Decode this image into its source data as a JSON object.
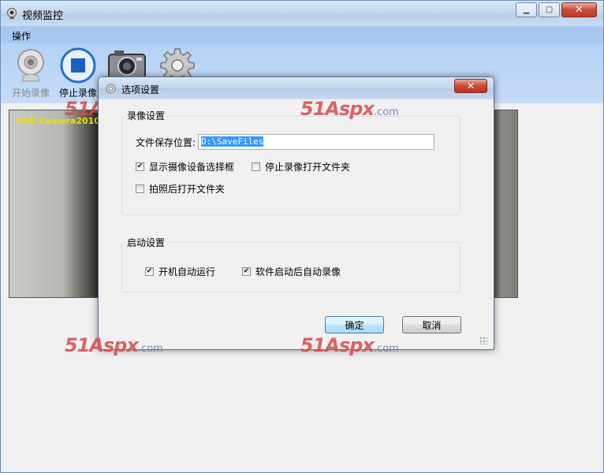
{
  "main_window": {
    "title": "视频监控",
    "menu": [
      "操作"
    ],
    "toolbar": [
      {
        "label": "开始录像",
        "icon": "webcam-icon",
        "enabled": false
      },
      {
        "label": "停止录像",
        "icon": "stop-icon",
        "enabled": true
      },
      {
        "label": "",
        "icon": "camera-icon",
        "enabled": true
      },
      {
        "label": "",
        "icon": "gear-icon",
        "enabled": true
      }
    ],
    "video_overlay": "USB Camera2010"
  },
  "watermark": {
    "brand": "51Aspx",
    "suffix": ".com"
  },
  "dialog": {
    "title": "选项设置",
    "close_glyph": "✕",
    "record_group": {
      "legend": "录像设置",
      "save_location_label": "文件保存位置:",
      "save_location_value": "D:\\SaveFiles",
      "checkboxes": [
        {
          "label": "显示摄像设备选择框",
          "checked": true
        },
        {
          "label": "停止录像打开文件夹",
          "checked": false
        },
        {
          "label": "拍照后打开文件夹",
          "checked": false
        }
      ]
    },
    "startup_group": {
      "legend": "启动设置",
      "checkboxes": [
        {
          "label": "开机自动运行",
          "checked": true
        },
        {
          "label": "软件启动后自动录像",
          "checked": true
        }
      ]
    },
    "ok_label": "确定",
    "cancel_label": "取消"
  },
  "colors": {
    "watermark": "#d24c4c",
    "menubar": "#a8c8f0",
    "overlay_text": "#f0e000"
  }
}
